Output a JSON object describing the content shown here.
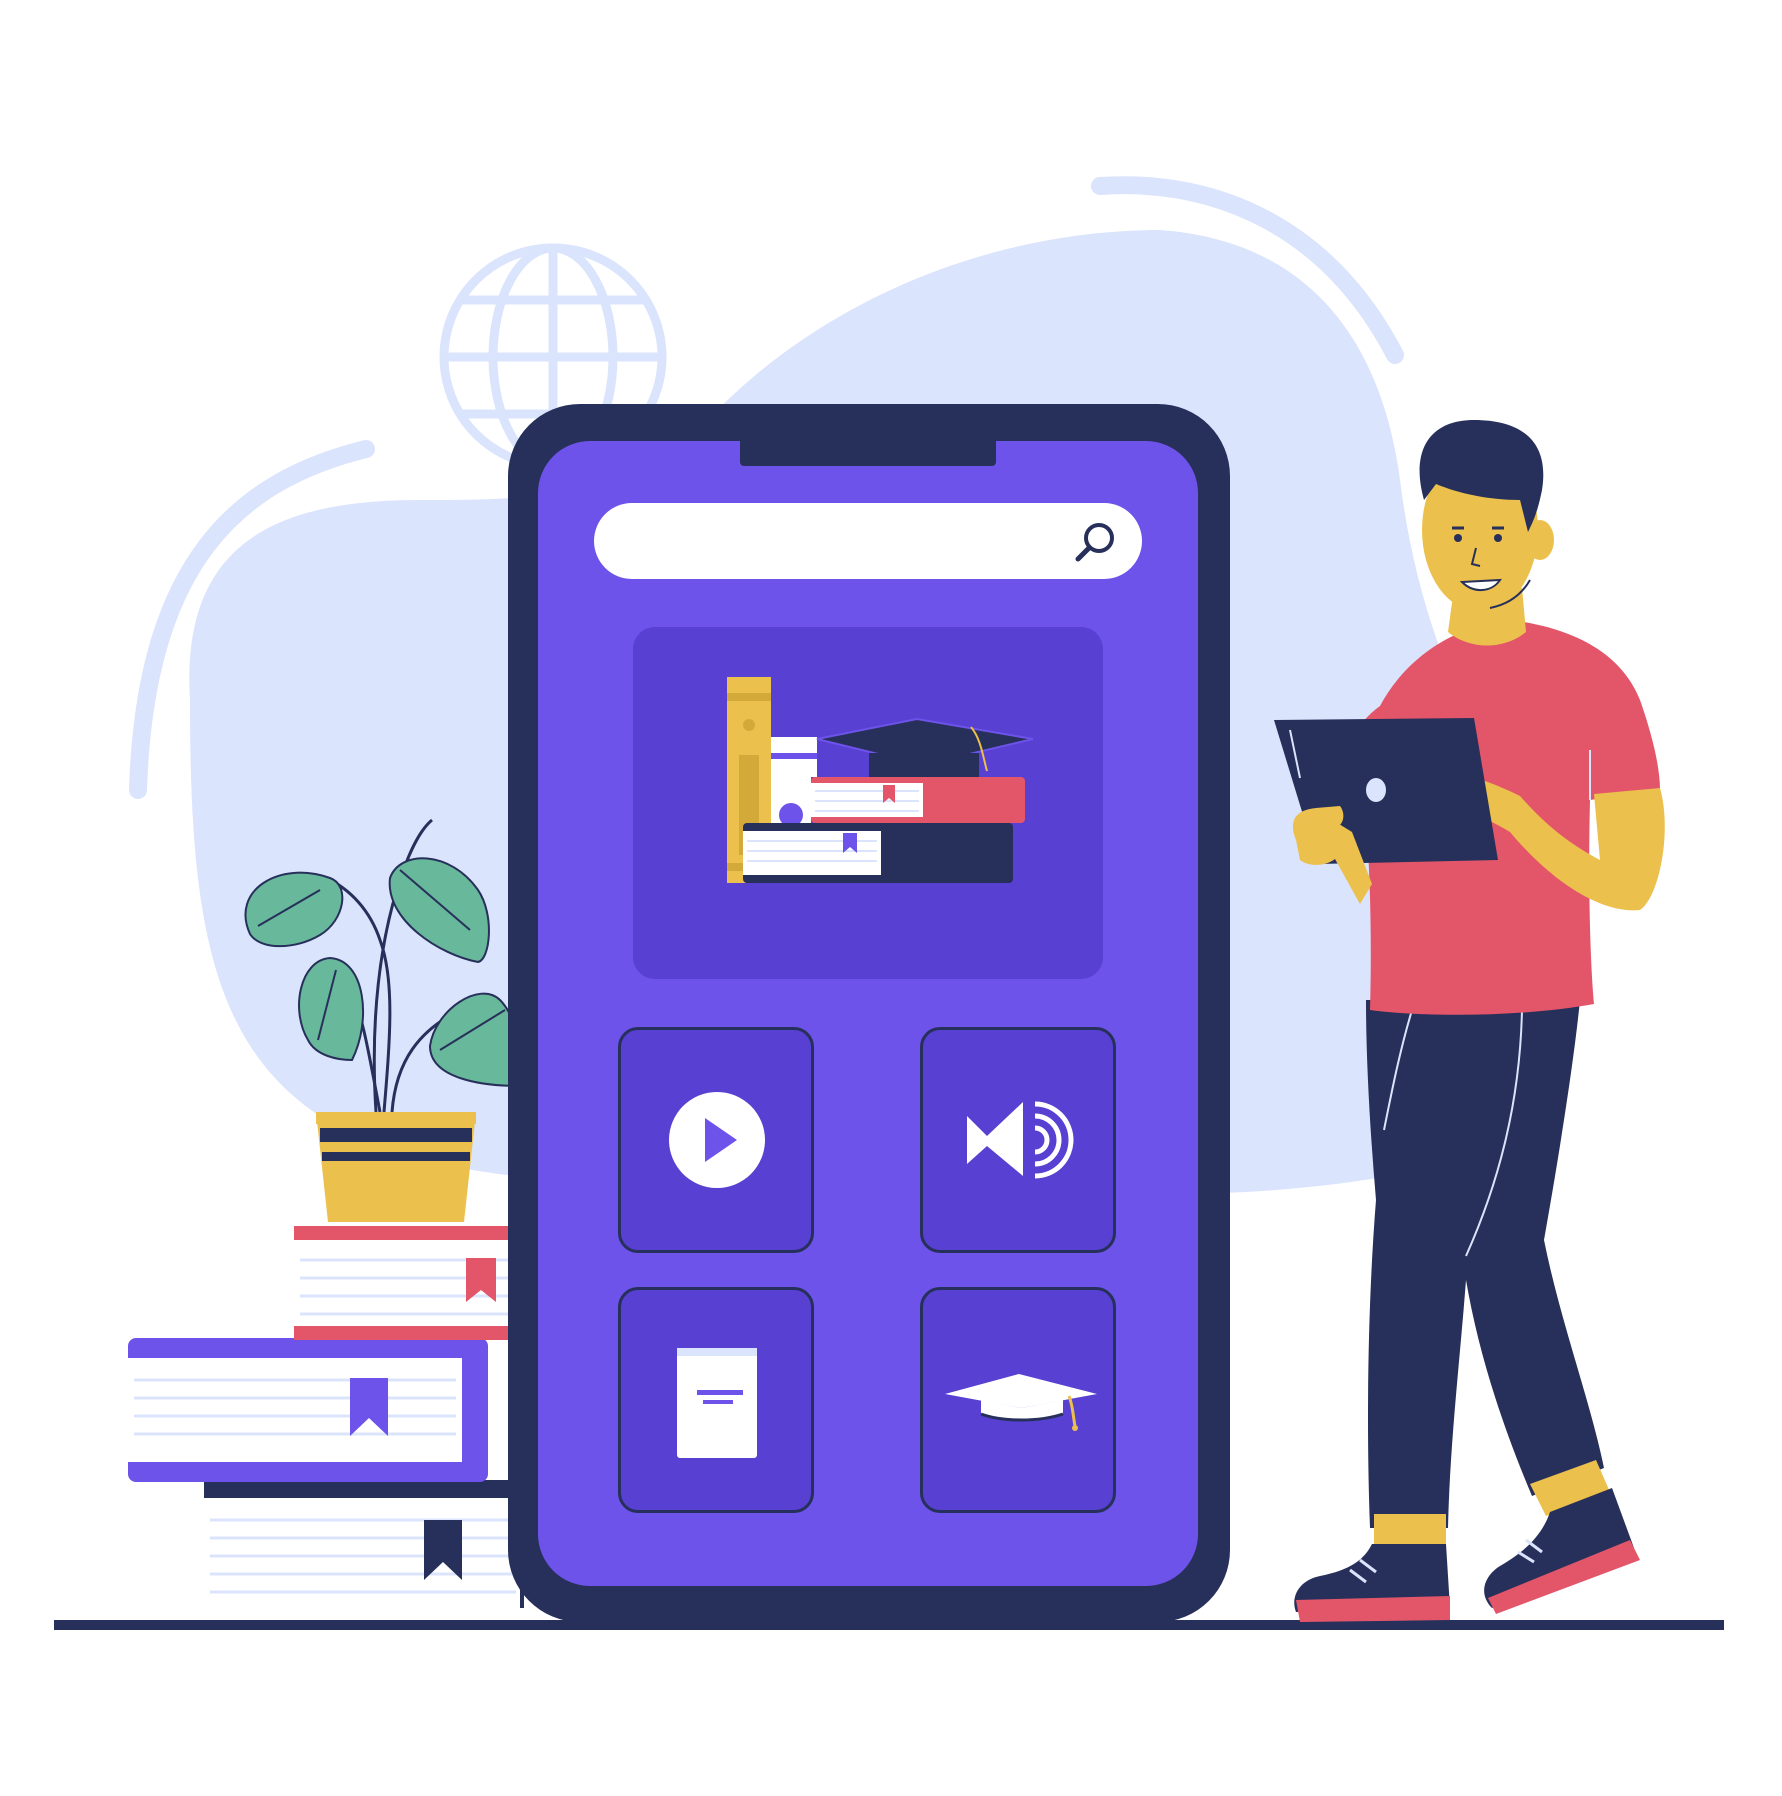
{
  "illustration": {
    "colors": {
      "background_blob": "#dbe4fd",
      "phone_body": "#27305a",
      "phone_screen": "#6e53ea",
      "tile": "#5740d2",
      "shirt": "#e35669",
      "skin": "#ebc04d",
      "leaf": "#68b89b",
      "accent_purple": "#6e53ea",
      "accent_red": "#e35669",
      "accent_yellow": "#ebc04d"
    },
    "decorations": [
      "globe-icon",
      "potted-plant",
      "book-stack",
      "person-with-tablet"
    ]
  },
  "app": {
    "search": {
      "value": "",
      "placeholder": "",
      "icon": "search-icon"
    },
    "hero": {
      "icon": "books-and-graduation-cap"
    },
    "tiles": [
      {
        "icon": "play-icon"
      },
      {
        "icon": "speaker-icon"
      },
      {
        "icon": "book-icon"
      },
      {
        "icon": "graduation-cap-icon"
      }
    ]
  }
}
